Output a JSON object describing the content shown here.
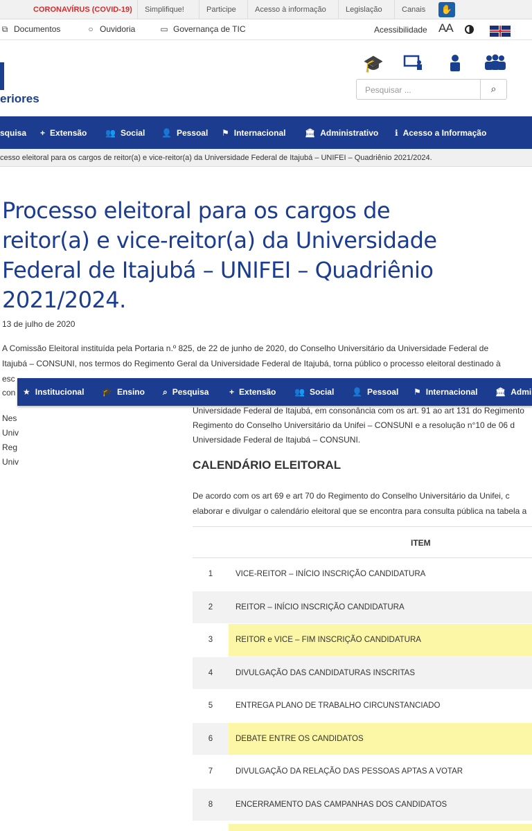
{
  "govbar": {
    "covid": "CORONAVÍRUS (COVID-19)",
    "items": [
      "Simplifique!",
      "Participe",
      "Acesso à informação",
      "Legislação",
      "Canais"
    ]
  },
  "subnav": {
    "links": [
      "Documentos",
      "Ouvidoria",
      "Governança de TIC"
    ],
    "accessibility": "Acessibilidade",
    "font_size": "AA"
  },
  "header": {
    "logo_fragment": "eriores",
    "search_placeholder": "Pesquisar ..."
  },
  "mainnav": {
    "items": [
      {
        "label": "squisa",
        "icon": ""
      },
      {
        "label": "Extensão",
        "icon": "+"
      },
      {
        "label": "Social",
        "icon": "👥"
      },
      {
        "label": "Pessoal",
        "icon": "👤"
      },
      {
        "label": "Internacional",
        "icon": "⚑"
      },
      {
        "label": "Administrativo",
        "icon": "🏛"
      },
      {
        "label": "Acesso a Informação",
        "icon": "ℹ"
      }
    ]
  },
  "breadcrumb": "cesso eleitoral para os cargos de reitor(a) e vice-reitor(a) da Universidade Federal de Itajubá – UNIFEI – Quadriênio 2021/2024.",
  "article": {
    "title": "Processo eleitoral para os cargos de reitor(a) e vice-reitor(a) da Universidade Federal de Itajubá – UNIFEI – Quadriênio 2021/2024.",
    "date": "13 de julho de 2020",
    "para_lines": [
      "A Comissão Eleitoral instituída pela Portaria n.º 825, de 22 de junho de 2020, do Conselho Universitário da Universidade Federal de",
      "Itajubá – CONSUNI, nos termos do Regimento Geral da Universidade Federal de Itajubá, torna público o processo eleitoral destinado à",
      "esc"
    ],
    "side_fragments": [
      "con",
      "Nes",
      "Univ",
      "Reg",
      "Univ"
    ],
    "body2_lines": [
      "Universidade Federal de Itajubá, em consonância com os art. 91 ao art 131 do Regimento",
      "Regimento do Conselho Universitário da Unifei – CONSUNI e a resolução n°10 de 06 d",
      "Universidade Federal de Itajubá – CONSUNI."
    ],
    "calendar_title": "CALENDÁRIO ELEITORAL",
    "body3_lines": [
      "De acordo com os art 69 e art 70 do Regimento do Conselho Universitário da Unifei, c",
      "elaborar e divulgar o calendário eleitoral que se encontra para consulta pública na tabela a"
    ]
  },
  "sticky_nav": {
    "items": [
      {
        "label": "Institucional",
        "icon": "★"
      },
      {
        "label": "Ensino",
        "icon": "🎓"
      },
      {
        "label": "Pesquisa",
        "icon": "🔍"
      },
      {
        "label": "Extensão",
        "icon": "+"
      },
      {
        "label": "Social",
        "icon": "👥"
      },
      {
        "label": "Pessoal",
        "icon": "👤"
      },
      {
        "label": "Internacional",
        "icon": "⚑"
      },
      {
        "label": "Admi",
        "icon": "🏛"
      }
    ]
  },
  "table": {
    "header": "ITEM",
    "rows": [
      {
        "num": "1",
        "text": "VICE-REITOR – INÍCIO INSCRIÇÃO CANDIDATURA",
        "highlight": false
      },
      {
        "num": "2",
        "text": "REITOR – INÍCIO INSCRIÇÃO CANDIDATURA",
        "highlight": false
      },
      {
        "num": "3",
        "text": "REITOR e VICE – FIM INSCRIÇÃO CANDIDATURA",
        "highlight": true
      },
      {
        "num": "4",
        "text": "DIVULGAÇÃO DAS CANDIDATURAS INSCRITAS",
        "highlight": false
      },
      {
        "num": "5",
        "text": "ENTREGA PLANO DE TRABALHO CIRCUNSTANCIADO",
        "highlight": false
      },
      {
        "num": "6",
        "text": "DEBATE ENTRE OS CANDIDATOS",
        "highlight": true
      },
      {
        "num": "7",
        "text": "DIVULGAÇÃO DA RELAÇÃO DAS PESSOAS APTAS A VOTAR",
        "highlight": false
      },
      {
        "num": "8",
        "text": "ENCERRAMENTO DAS CAMPANHAS DOS CANDIDATOS",
        "highlight": false
      }
    ]
  },
  "colors": {
    "brand": "#1b3c8f",
    "highlight": "#fbf7a6",
    "covid": "#d62b2b"
  }
}
